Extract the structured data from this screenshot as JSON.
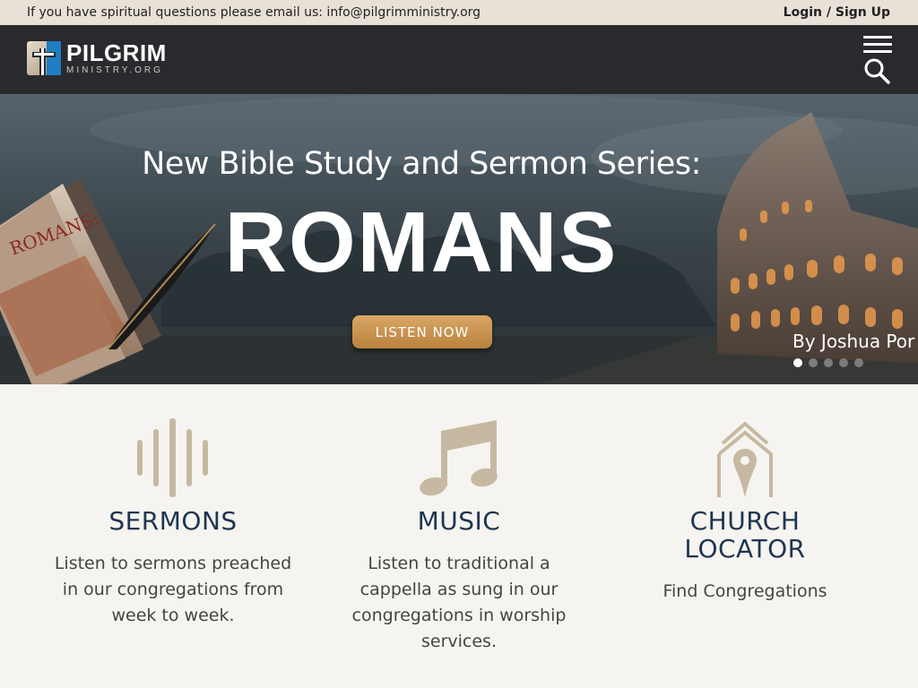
{
  "topbar": {
    "message": "If you have spiritual questions please email us: info@pilgrimministry.org",
    "login": "Login / Sign Up"
  },
  "header": {
    "logo_line1": "PILGRIM",
    "logo_line2": "MINISTRY.ORG"
  },
  "hero": {
    "heading": "New Bible Study and Sermon Series:",
    "title": "ROMANS",
    "button": "LISTEN NOW",
    "byline": "By Joshua Por",
    "slides": 5,
    "active_slide": 1
  },
  "features": [
    {
      "title": "SERMONS",
      "text": "Listen to sermons preached in our congregations from week to week.",
      "icon": "sound-wave-icon"
    },
    {
      "title": "MUSIC",
      "text": "Listen to traditional a cappella as sung in our congregations in worship services.",
      "icon": "music-note-icon"
    },
    {
      "title_line1": "CHURCH",
      "title_line2": "LOCATOR",
      "text": "Find Congregations",
      "icon": "church-location-icon"
    }
  ],
  "colors": {
    "topbar_bg": "#e9e1d8",
    "header_bg": "#2a2a2e",
    "accent_gold": "#c89554",
    "icon_tan": "#c7b9a1",
    "heading_navy": "#1e3550"
  }
}
